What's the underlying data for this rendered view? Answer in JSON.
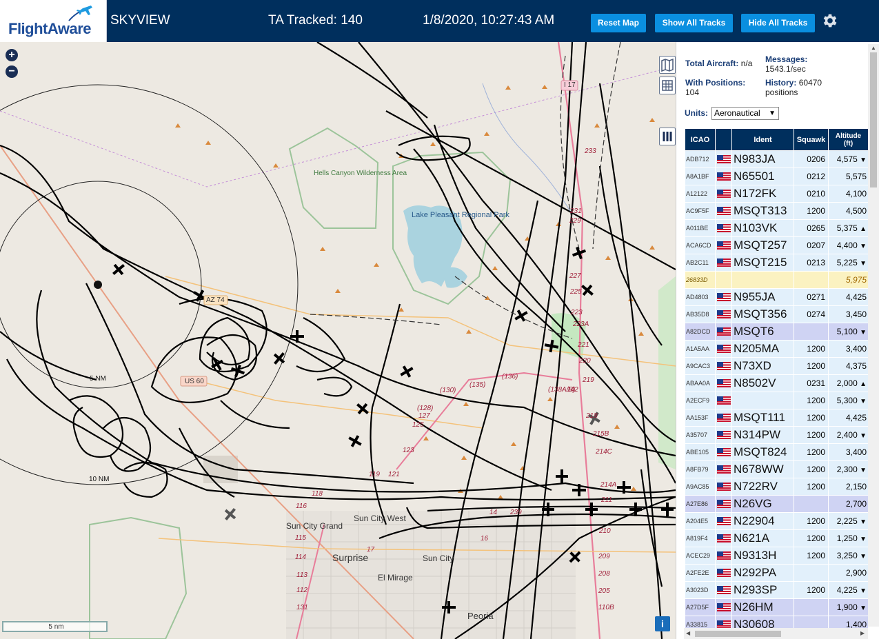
{
  "header": {
    "logo_text": "FlightAware",
    "app_title": "SKYVIEW",
    "ta_tracked": "TA Tracked: 140",
    "clock": "1/8/2020, 10:27:43 AM",
    "reset_label": "Reset Map",
    "show_label": "Show All Tracks",
    "hide_label": "Hide All Tracks",
    "settings_icon": "gear-icon",
    "colors": {
      "bar": "#002f5d",
      "button": "#0a8fe0"
    }
  },
  "map": {
    "zoom_in": "+",
    "zoom_out": "−",
    "labels": {
      "hells_canyon": "Hells Canyon Wilderness Area",
      "lake_pleasant": "Lake Pleasant Regional Park",
      "sun_city_grand": "Sun City Grand",
      "sun_city_west": "Sun City West",
      "surprise": "Surprise",
      "sun_city": "Sun City",
      "el_mirage": "El Mirage",
      "peoria": "Peoria",
      "us60": "US 60",
      "az74": "AZ 74",
      "i17": "I 17",
      "ring5": "5 NM",
      "ring10": "10 NM"
    },
    "route_labels": [
      "(130)",
      "(128)",
      "127",
      "125",
      "123",
      "121",
      "119",
      "118",
      "116",
      "115",
      "114",
      "113",
      "112",
      "131",
      "(135)",
      "(136)",
      "(138A/B)",
      "142",
      "17",
      "14",
      "16",
      "239",
      "233",
      "231",
      "229",
      "227",
      "225",
      "223",
      "223A",
      "221",
      "220",
      "219",
      "218",
      "215B",
      "214C",
      "214A",
      "211",
      "210",
      "209",
      "208",
      "205",
      "110B"
    ],
    "scale_label": "5 nm",
    "info_label": "i"
  },
  "sidebar": {
    "total_aircraft_label": "Total Aircraft:",
    "total_aircraft_value": "n/a",
    "messages_label": "Messages:",
    "messages_value": "1543.1/sec",
    "with_positions_label": "With Positions:",
    "with_positions_value": "104",
    "history_label": "History:",
    "history_value": "60470",
    "history_unit": "positions",
    "units_label": "Units:",
    "units_value": "Aeronautical",
    "columns": {
      "icao": "ICAO",
      "ident": "Ident",
      "squawk": "Squawk",
      "altitude": "Altitude",
      "altitude_unit": "(ft)"
    },
    "rows": [
      {
        "icao": "ADB712",
        "ident": "N983JA",
        "squawk": "0206",
        "alt": "4,575",
        "trend": "▼",
        "flag": true,
        "style": ""
      },
      {
        "icao": "A8A1BF",
        "ident": "N65501",
        "squawk": "0212",
        "alt": "5,575",
        "trend": "",
        "flag": true,
        "style": ""
      },
      {
        "icao": "A12122",
        "ident": "N172FK",
        "squawk": "0210",
        "alt": "4,100",
        "trend": "",
        "flag": true,
        "style": ""
      },
      {
        "icao": "AC9F5F",
        "ident": "MSQT313",
        "squawk": "1200",
        "alt": "4,500",
        "trend": "",
        "flag": true,
        "style": ""
      },
      {
        "icao": "A011BE",
        "ident": "N103VK",
        "squawk": "0265",
        "alt": "5,375",
        "trend": "▲",
        "flag": true,
        "style": ""
      },
      {
        "icao": "ACA6CD",
        "ident": "MSQT257",
        "squawk": "0207",
        "alt": "4,400",
        "trend": "▼",
        "flag": true,
        "style": ""
      },
      {
        "icao": "AB2C11",
        "ident": "MSQT215",
        "squawk": "0213",
        "alt": "5,225",
        "trend": "▼",
        "flag": true,
        "style": ""
      },
      {
        "icao": "26833D",
        "ident": "",
        "squawk": "",
        "alt": "5,975",
        "trend": "",
        "flag": false,
        "style": "yellow"
      },
      {
        "icao": "AD4803",
        "ident": "N955JA",
        "squawk": "0271",
        "alt": "4,425",
        "trend": "",
        "flag": true,
        "style": ""
      },
      {
        "icao": "AB35D8",
        "ident": "MSQT356",
        "squawk": "0274",
        "alt": "3,450",
        "trend": "",
        "flag": true,
        "style": ""
      },
      {
        "icao": "A82DCD",
        "ident": "MSQT6",
        "squawk": "",
        "alt": "5,100",
        "trend": "▼",
        "flag": true,
        "style": "sel"
      },
      {
        "icao": "A1A5AA",
        "ident": "N205MA",
        "squawk": "1200",
        "alt": "3,400",
        "trend": "",
        "flag": true,
        "style": ""
      },
      {
        "icao": "A9CAC3",
        "ident": "N73XD",
        "squawk": "1200",
        "alt": "4,375",
        "trend": "",
        "flag": true,
        "style": ""
      },
      {
        "icao": "ABAA0A",
        "ident": "N8502V",
        "squawk": "0231",
        "alt": "2,000",
        "trend": "▲",
        "flag": true,
        "style": ""
      },
      {
        "icao": "A2ECF9",
        "ident": "",
        "squawk": "1200",
        "alt": "5,300",
        "trend": "▼",
        "flag": true,
        "style": ""
      },
      {
        "icao": "AA153F",
        "ident": "MSQT111",
        "squawk": "1200",
        "alt": "4,425",
        "trend": "",
        "flag": true,
        "style": ""
      },
      {
        "icao": "A35707",
        "ident": "N314PW",
        "squawk": "1200",
        "alt": "2,400",
        "trend": "▼",
        "flag": true,
        "style": ""
      },
      {
        "icao": "ABE105",
        "ident": "MSQT824",
        "squawk": "1200",
        "alt": "3,400",
        "trend": "",
        "flag": true,
        "style": ""
      },
      {
        "icao": "A8FB79",
        "ident": "N678WW",
        "squawk": "1200",
        "alt": "2,300",
        "trend": "▼",
        "flag": true,
        "style": ""
      },
      {
        "icao": "A9AC85",
        "ident": "N722RV",
        "squawk": "1200",
        "alt": "2,150",
        "trend": "",
        "flag": true,
        "style": ""
      },
      {
        "icao": "A27E86",
        "ident": "N26VG",
        "squawk": "",
        "alt": "2,700",
        "trend": "",
        "flag": true,
        "style": "sel"
      },
      {
        "icao": "A204E5",
        "ident": "N22904",
        "squawk": "1200",
        "alt": "2,225",
        "trend": "▼",
        "flag": true,
        "style": ""
      },
      {
        "icao": "A819F4",
        "ident": "N621A",
        "squawk": "1200",
        "alt": "1,250",
        "trend": "▼",
        "flag": true,
        "style": ""
      },
      {
        "icao": "ACEC29",
        "ident": "N9313H",
        "squawk": "1200",
        "alt": "3,250",
        "trend": "▼",
        "flag": true,
        "style": ""
      },
      {
        "icao": "A2FE2E",
        "ident": "N292PA",
        "squawk": "",
        "alt": "2,900",
        "trend": "",
        "flag": true,
        "style": ""
      },
      {
        "icao": "A3023D",
        "ident": "N293SP",
        "squawk": "1200",
        "alt": "4,225",
        "trend": "▼",
        "flag": true,
        "style": ""
      },
      {
        "icao": "A27D5F",
        "ident": "N26HM",
        "squawk": "",
        "alt": "1,900",
        "trend": "▼",
        "flag": true,
        "style": "sel"
      },
      {
        "icao": "A33815",
        "ident": "N30608",
        "squawk": "",
        "alt": "1,400",
        "trend": "",
        "flag": true,
        "style": "sel"
      }
    ]
  }
}
